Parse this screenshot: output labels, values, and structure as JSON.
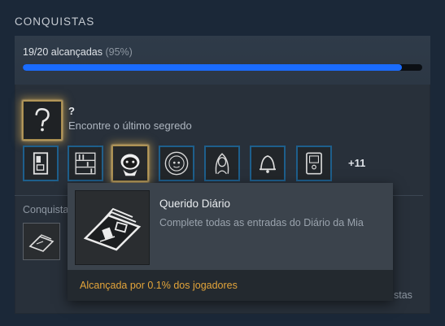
{
  "section": {
    "title": "CONQUISTAS"
  },
  "progress": {
    "label": "19/20 alcançadas",
    "percent_label": "(95%)",
    "fraction": 0.95
  },
  "hidden_achievement": {
    "name": "?",
    "description": "Encontre o último segredo",
    "icon": "question-mark-icon"
  },
  "achievements_row": [
    {
      "icon": "locked-door-icon"
    },
    {
      "icon": "bookshelf-icon"
    },
    {
      "icon": "dark-creature-icon",
      "highlighted": true
    },
    {
      "icon": "face-emblem-icon"
    },
    {
      "icon": "woman-portrait-icon"
    },
    {
      "icon": "bell-icon"
    },
    {
      "icon": "cabinet-door-icon"
    }
  ],
  "more_count": "+11",
  "subsection": {
    "label_visible": "Conquista",
    "right_fragment": "stas"
  },
  "tooltip": {
    "name": "Querido Diário",
    "description": "Complete todas as entradas do Diário da Mia",
    "rarity": "Alcançada por 0.1% dos jogadores",
    "icon": "diary-book-icon"
  },
  "colors": {
    "accent_blue": "#1a6cff",
    "rarity_gold": "#e3a43a",
    "background": "#1b2838"
  }
}
